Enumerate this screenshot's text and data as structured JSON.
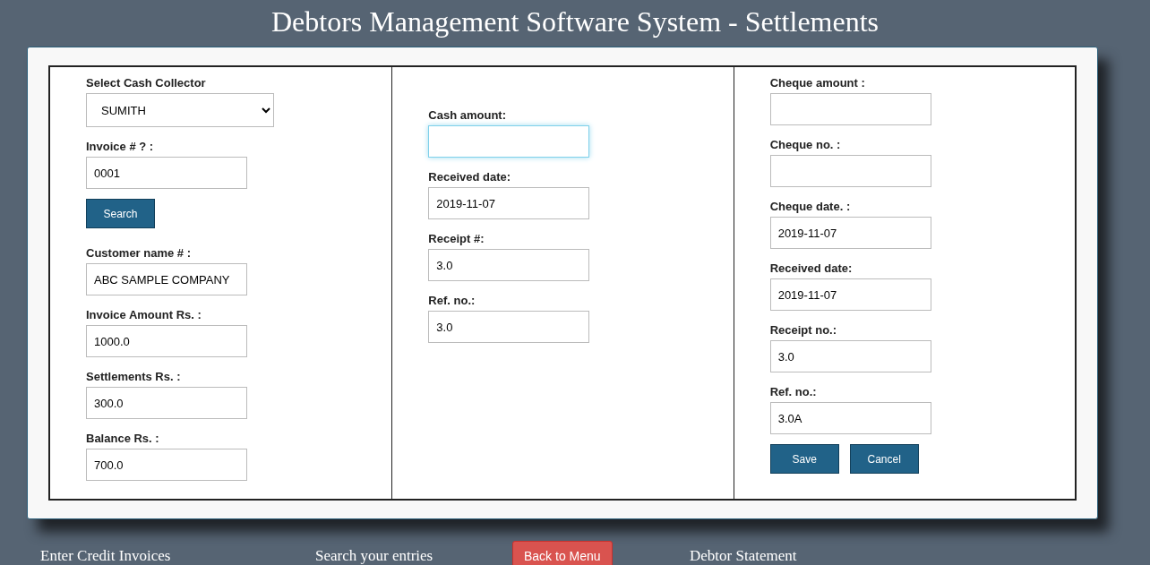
{
  "title": "Debtors Management Software System - Settlements",
  "columns": [
    {
      "items": [
        {
          "kind": "select",
          "label": "Select Cash Collector",
          "value": "SUMITH"
        },
        {
          "kind": "field",
          "label": "Invoice # ? :",
          "value": "0001",
          "focused": false
        },
        {
          "kind": "buttons",
          "buttons": [
            "Search"
          ]
        },
        {
          "kind": "field",
          "label": "Customer name # :",
          "value": "ABC SAMPLE COMPANY",
          "focused": false
        },
        {
          "kind": "field",
          "label": "Invoice Amount Rs. :",
          "value": "1000.0",
          "focused": false
        },
        {
          "kind": "field",
          "label": "Settlements Rs. :",
          "value": "300.0",
          "focused": false
        },
        {
          "kind": "field",
          "label": "Balance Rs. :",
          "value": "700.0",
          "focused": false
        }
      ]
    },
    {
      "items": [
        {
          "kind": "field",
          "label": "Cash amount:",
          "value": "",
          "focused": true
        },
        {
          "kind": "field",
          "label": "Received date:",
          "value": "2019-11-07",
          "focused": false
        },
        {
          "kind": "field",
          "label": "Receipt #:",
          "value": "3.0",
          "focused": false
        },
        {
          "kind": "field",
          "label": "Ref. no.:",
          "value": "3.0",
          "focused": false
        }
      ]
    },
    {
      "items": [
        {
          "kind": "field",
          "label": "Cheque amount :",
          "value": "",
          "focused": false
        },
        {
          "kind": "field",
          "label": "Cheque no. :",
          "value": "",
          "focused": false
        },
        {
          "kind": "field",
          "label": "Cheque date. :",
          "value": "2019-11-07",
          "focused": false
        },
        {
          "kind": "field",
          "label": "Received date:",
          "value": "2019-11-07",
          "focused": false
        },
        {
          "kind": "field",
          "label": "Receipt no.:",
          "value": "3.0",
          "focused": false
        },
        {
          "kind": "field",
          "label": "Ref. no.:",
          "value": "3.0A",
          "focused": false
        },
        {
          "kind": "buttons",
          "buttons": [
            "Save",
            "Cancel"
          ]
        }
      ]
    }
  ],
  "footer": [
    {
      "kind": "link",
      "text": "Enter Credit Invoices"
    },
    {
      "kind": "link",
      "text": "Search your entries"
    },
    {
      "kind": "button",
      "text": "Back to Menu"
    },
    {
      "kind": "link",
      "text": "Debtor Statement"
    }
  ]
}
